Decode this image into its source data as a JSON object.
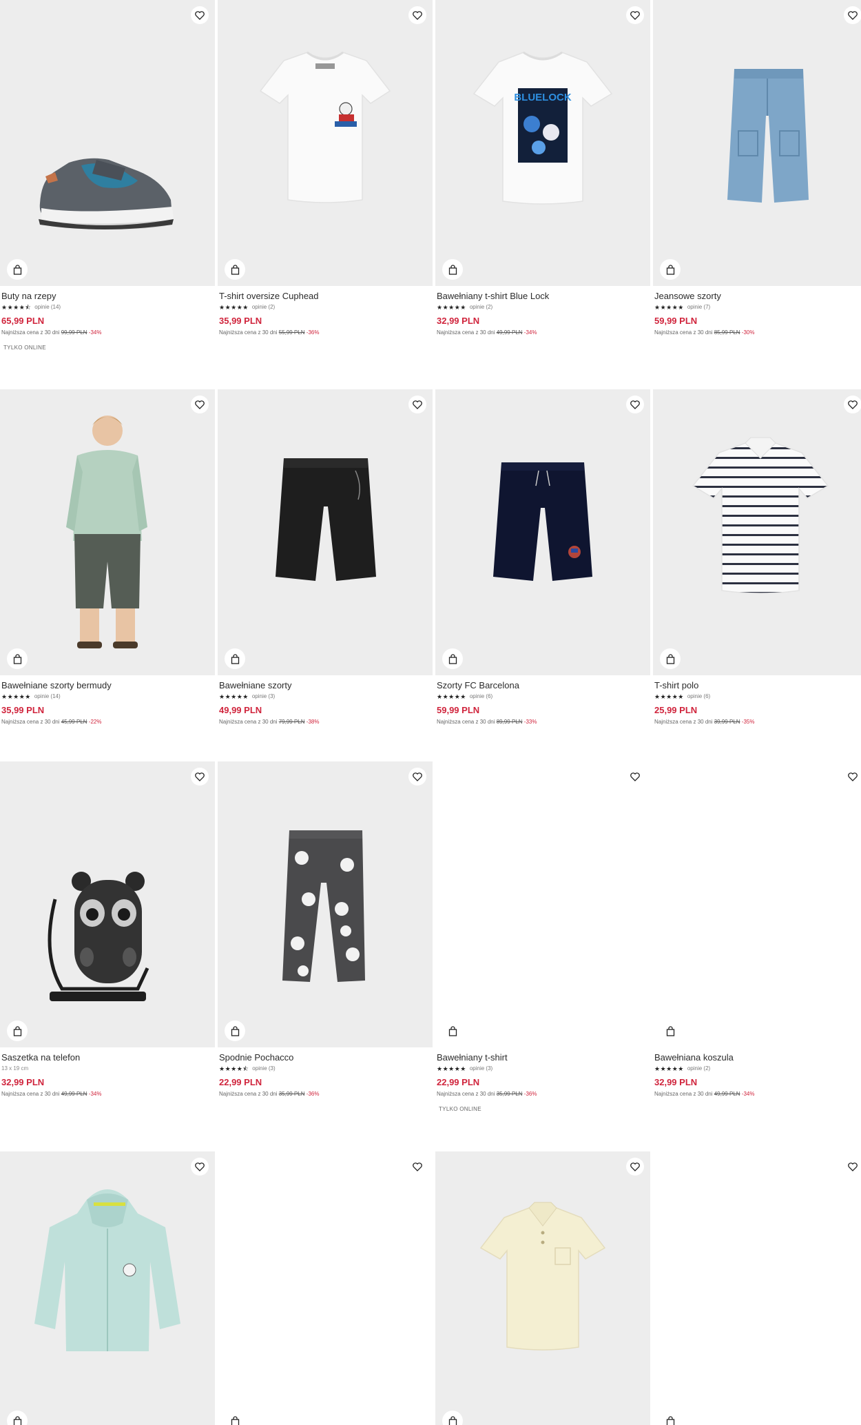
{
  "products": [
    {
      "name": "Buty na rzepy",
      "stars": "★★★★⯪",
      "reviews": "opinie (14)",
      "price": "65,99 PLN",
      "lowest_label": "Najniższa cena z 30 dni",
      "old_price": "99,99 PLN",
      "discount": "-34%",
      "badge": "TYLKO ONLINE",
      "image": "sneaker"
    },
    {
      "name": "T-shirt oversize Cuphead",
      "stars": "★★★★★",
      "reviews": "opinie (2)",
      "price": "35,99 PLN",
      "lowest_label": "Najniższa cena z 30 dni",
      "old_price": "55,99 PLN",
      "discount": "-36%",
      "image": "tshirt-cuphead"
    },
    {
      "name": "Bawełniany t-shirt Blue Lock",
      "stars": "★★★★★",
      "reviews": "opinie (2)",
      "price": "32,99 PLN",
      "lowest_label": "Najniższa cena z 30 dni",
      "old_price": "49,99 PLN",
      "discount": "-34%",
      "image": "tshirt-bluelock"
    },
    {
      "name": "Jeansowe szorty",
      "stars": "★★★★★",
      "reviews": "opinie (7)",
      "price": "59,99 PLN",
      "lowest_label": "Najniższa cena z 30 dni",
      "old_price": "85,99 PLN",
      "discount": "-30%",
      "image": "denim-shorts"
    },
    {
      "name": "Bawełniane szorty bermudy",
      "stars": "★★★★★",
      "reviews": "opinie (14)",
      "price": "35,99 PLN",
      "lowest_label": "Najniższa cena z 30 dni",
      "old_price": "45,99 PLN",
      "discount": "-22%",
      "image": "boy-model"
    },
    {
      "name": "Bawełniane szorty",
      "stars": "★★★★★",
      "reviews": "opinie (3)",
      "price": "49,99 PLN",
      "lowest_label": "Najniższa cena z 30 dni",
      "old_price": "79,99 PLN",
      "discount": "-38%",
      "image": "black-shorts"
    },
    {
      "name": "Szorty FC Barcelona",
      "stars": "★★★★★",
      "reviews": "opinie (6)",
      "price": "59,99 PLN",
      "lowest_label": "Najniższa cena z 30 dni",
      "old_price": "89,99 PLN",
      "discount": "-33%",
      "image": "navy-shorts"
    },
    {
      "name": "T-shirt polo",
      "stars": "★★★★★",
      "reviews": "opinie (6)",
      "price": "25,99 PLN",
      "lowest_label": "Najniższa cena z 30 dni",
      "old_price": "39,99 PLN",
      "discount": "-35%",
      "image": "striped-polo"
    },
    {
      "name": "Saszetka na telefon",
      "sub": "13 x 19 cm",
      "price": "32,99 PLN",
      "lowest_label": "Najniższa cena z 30 dni",
      "old_price": "49,99 PLN",
      "discount": "-34%",
      "image": "phone-pouch"
    },
    {
      "name": "Spodnie Pochacco",
      "stars": "★★★★⯪",
      "reviews": "opinie (3)",
      "price": "22,99 PLN",
      "lowest_label": "Najniższa cena z 30 dni",
      "old_price": "35,99 PLN",
      "discount": "-36%",
      "image": "pochacco-pants"
    },
    {
      "name": "Bawełniany t-shirt",
      "stars": "★★★★★",
      "reviews": "opinie (3)",
      "price": "22,99 PLN",
      "lowest_label": "Najniższa cena z 30 dni",
      "old_price": "35,99 PLN",
      "discount": "-36%",
      "badge": "TYLKO ONLINE",
      "image": "blank"
    },
    {
      "name": "Bawełniana koszula",
      "stars": "★★★★★",
      "reviews": "opinie (2)",
      "price": "32,99 PLN",
      "lowest_label": "Najniższa cena z 30 dni",
      "old_price": "49,99 PLN",
      "discount": "-34%",
      "image": "blank"
    },
    {
      "image": "mint-hoodie"
    },
    {
      "image": "blank"
    },
    {
      "image": "cream-polo"
    },
    {
      "image": "blank"
    }
  ],
  "colors": {
    "price": "#d0243c",
    "tile_bg": "#ededed"
  },
  "icons": {
    "favorite": "heart-icon",
    "cart": "shopping-bag-icon"
  }
}
